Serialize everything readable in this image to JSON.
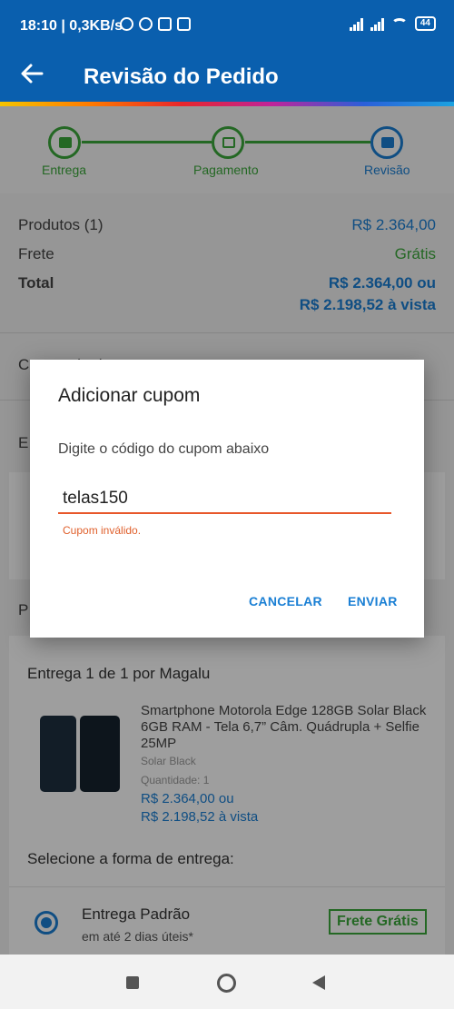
{
  "status_bar": {
    "time_text": "18:10 | 0,3KB/s",
    "battery": "44",
    "icons": [
      "alarm-icon",
      "whatsapp-icon",
      "instagram-icon",
      "gmail-icon"
    ]
  },
  "app_bar": {
    "title": "Revisão do Pedido",
    "back_icon": "arrow-left-icon",
    "color": "#0a5fae"
  },
  "stepper": {
    "steps": [
      {
        "label": "Entrega",
        "icon": "truck-icon"
      },
      {
        "label": "Pagamento",
        "icon": "card-icon"
      },
      {
        "label": "Revisão",
        "icon": "document-icon"
      }
    ],
    "complete_color": "#3ba83a",
    "active_color": "#1a7fd4"
  },
  "summary": {
    "products_label": "Produtos (1)",
    "products_value": "R$ 2.364,00",
    "shipping_label": "Frete",
    "shipping_value": "Grátis",
    "total_label": "Total",
    "total_value_line1": "R$ 2.364,00 ou",
    "total_value_line2": "R$ 2.198,52 à vista"
  },
  "background": {
    "coupon_row_partial": "Cupom de desconto",
    "delivery_header": "Entrega 1 de 1 por Magalu",
    "product": {
      "name": "Smartphone Motorola Edge 128GB Solar Black 6GB RAM - Tela 6,7” Câm. Quádrupla + Selfie 25MP",
      "color": "Solar Black",
      "quantity": "Quantidade:  1",
      "price_line1": "R$ 2.364,00 ou",
      "price_line2": "R$ 2.198,52 à vista"
    },
    "select_delivery_label": "Selecione a forma de entrega:",
    "delivery_option": {
      "title": "Entrega Padrão",
      "subtitle": "em até 2 dias úteis*",
      "badge": "Frete Grátis"
    }
  },
  "dialog": {
    "title": "Adicionar cupom",
    "message": "Digite o código do cupom abaixo",
    "input_value": "telas150",
    "error": "Cupom inválido.",
    "cancel_label": "CANCELAR",
    "submit_label": "ENVIAR",
    "error_color": "#e0602c",
    "accent_color": "#1a7fd4"
  },
  "nav_bar": {
    "buttons": [
      "recents-square-icon",
      "home-circle-icon",
      "back-triangle-icon"
    ]
  }
}
